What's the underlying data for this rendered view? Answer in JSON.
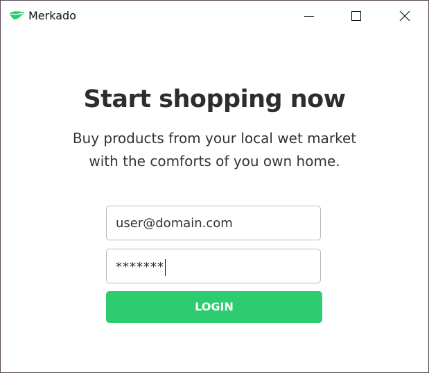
{
  "window": {
    "title": "Merkado",
    "logo_icon": "leaf-icon",
    "controls": [
      "minimize-icon",
      "maximize-icon",
      "close-icon"
    ]
  },
  "hero": {
    "headline": "Start shopping now",
    "subtitle_line1": "Buy products from your local wet market",
    "subtitle_line2": "with the comforts of you own home."
  },
  "form": {
    "email_value": "user@domain.com",
    "password_value": "*******",
    "login_label": "LOGIN"
  },
  "colors": {
    "accent": "#2ecc71",
    "headline": "#2d2d2d",
    "border": "#b9b9b9"
  }
}
